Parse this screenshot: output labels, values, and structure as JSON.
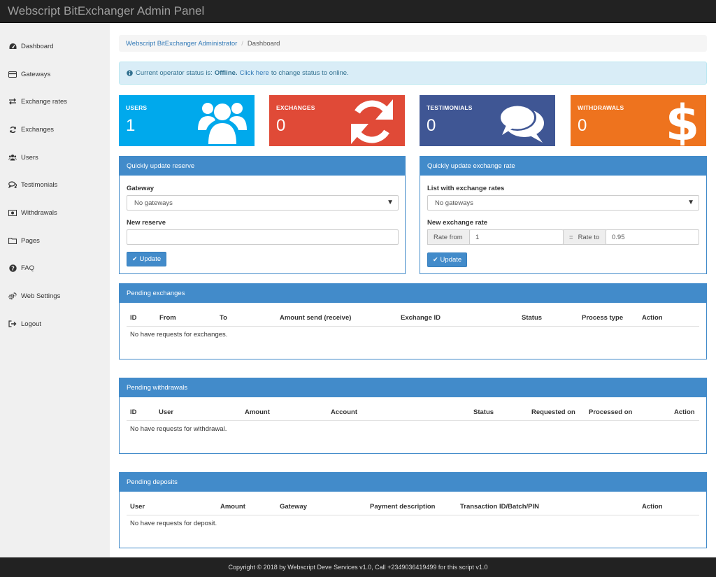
{
  "app": {
    "title": "Webscript BitExchanger Admin Panel"
  },
  "sidebar": {
    "items": [
      {
        "label": "Dashboard",
        "icon": "dashboard-icon"
      },
      {
        "label": "Gateways",
        "icon": "credit-card-icon"
      },
      {
        "label": "Exchange rates",
        "icon": "exchange-icon"
      },
      {
        "label": "Exchanges",
        "icon": "refresh-icon"
      },
      {
        "label": "Users",
        "icon": "users-icon"
      },
      {
        "label": "Testimonials",
        "icon": "comments-icon"
      },
      {
        "label": "Withdrawals",
        "icon": "money-icon"
      },
      {
        "label": "Pages",
        "icon": "folder-icon"
      },
      {
        "label": "FAQ",
        "icon": "question-icon"
      },
      {
        "label": "Web Settings",
        "icon": "cogs-icon"
      },
      {
        "label": "Logout",
        "icon": "sign-out-icon"
      }
    ]
  },
  "breadcrumb": {
    "root": "Webscript BitExchanger Administrator",
    "separator": "/",
    "current": "Dashboard"
  },
  "alert": {
    "prefix": "Current operator status is:",
    "status": "Offline.",
    "link": "Click here",
    "suffix": "to change status to online."
  },
  "stats": [
    {
      "label": "USERS",
      "value": "1",
      "color": "#00a9ec",
      "icon": "users-icon"
    },
    {
      "label": "EXCHANGES",
      "value": "0",
      "color": "#e04a37",
      "icon": "refresh-icon"
    },
    {
      "label": "TESTIMONIALS",
      "value": "0",
      "color": "#3f5694",
      "icon": "comments-icon"
    },
    {
      "label": "WITHDRAWALS",
      "value": "0",
      "color": "#ee731e",
      "icon": "dollar-icon"
    }
  ],
  "reserve_panel": {
    "title": "Quickly update reserve",
    "gateway_label": "Gateway",
    "gateway_value": "No gateways",
    "reserve_label": "New reserve",
    "reserve_value": "",
    "button": "Update"
  },
  "rate_panel": {
    "title": "Quickly update exchange rate",
    "list_label": "List with exchange rates",
    "list_value": "No gateways",
    "rate_label": "New exchange rate",
    "rate_from_label": "Rate from",
    "rate_from_value": "1",
    "eq": "=",
    "rate_to_label": "Rate to",
    "rate_to_value": "0.95",
    "button": "Update"
  },
  "pending_exchanges": {
    "title": "Pending exchanges",
    "columns": [
      "ID",
      "From",
      "To",
      "Amount send (receive)",
      "Exchange ID",
      "Status",
      "Process type",
      "Action"
    ],
    "empty": "No have requests for exchanges."
  },
  "pending_withdrawals": {
    "title": "Pending withdrawals",
    "columns": [
      "ID",
      "User",
      "Amount",
      "Account",
      "Status",
      "Requested on",
      "Processed on",
      "Action"
    ],
    "empty": "No have requests for withdrawal."
  },
  "pending_deposits": {
    "title": "Pending deposits",
    "columns": [
      "User",
      "Amount",
      "Gateway",
      "Payment description",
      "Transaction ID/Batch/PIN",
      "Action"
    ],
    "empty": "No have requests for deposit."
  },
  "footer": {
    "text": "Copyright © 2018 by Webscript Deve Services v1.0, Call +2349036419499 for this script v1.0"
  }
}
